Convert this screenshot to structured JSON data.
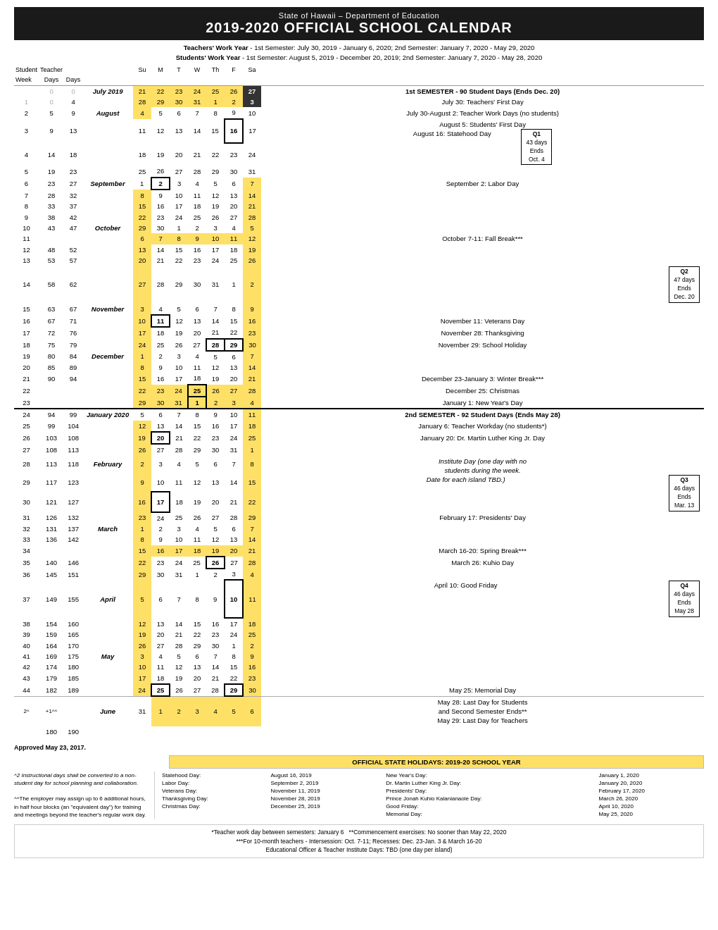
{
  "header": {
    "subtitle": "State of Hawaii – Department of Education",
    "title": "2019-2020 OFFICIAL SCHOOL CALENDAR",
    "teachers_work_year": "Teachers' Work Year",
    "teachers_work_year_detail": "- 1st Semester: July 30, 2019 - January 6, 2020; 2nd Semester: January 7, 2020 - May 29, 2020",
    "students_work_year": "Students' Work Year",
    "students_work_year_detail": "- 1st Semester: August 5, 2019 - December 20, 2019; 2nd Semester: January 7, 2020 - May 28, 2020"
  },
  "col_headers": {
    "week": "Week",
    "student_days": "Student Days",
    "teacher_days": "Teacher Days",
    "su": "Su",
    "m": "M",
    "t": "T",
    "w": "W",
    "th": "Th",
    "f": "F",
    "sa": "Sa"
  },
  "quarters": {
    "q1": {
      "title": "Q1",
      "days": "43 days",
      "ends": "Ends Oct. 4"
    },
    "q2": {
      "title": "Q2",
      "days": "47 days",
      "ends": "Ends Dec. 20"
    },
    "q3": {
      "title": "Q3",
      "days": "46 days",
      "ends": "Ends Mar. 13"
    },
    "q4": {
      "title": "Q4",
      "days": "46 days",
      "ends": "Ends May 28"
    }
  },
  "approved": "Approved May 23, 2017.",
  "holidays_header": "OFFICIAL STATE HOLIDAYS: 2019-20 SCHOOL YEAR",
  "footnotes_text": "*Teacher work day between semesters: January 6  **Commencement exercises: No sooner than May 22, 2020\n***For 10-month teachers - Intersession: Oct. 7-11; Recesses: Dec. 23-Jan. 3 & March 16-20\nEducational Officer & Teacher Institute Days: TBD (one day per island)"
}
